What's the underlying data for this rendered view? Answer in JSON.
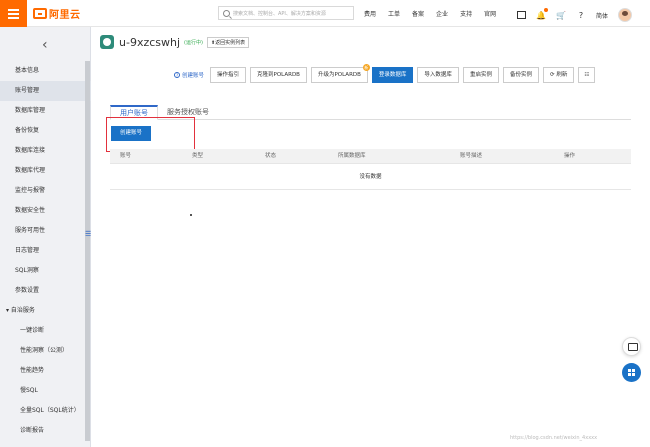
{
  "topbar": {
    "logo_text": "阿里云",
    "search_placeholder": "搜索文档、控制台、API、解决方案和资源",
    "nav": [
      "费用",
      "工单",
      "备案",
      "企业",
      "支持",
      "官网"
    ],
    "language": "简体",
    "brand_color": "#ff6a00"
  },
  "sidebar": {
    "items": [
      {
        "label": "基本信息",
        "type": "item"
      },
      {
        "label": "账号管理",
        "type": "item",
        "active": true
      },
      {
        "label": "数据库管理",
        "type": "item"
      },
      {
        "label": "备份恢复",
        "type": "item"
      },
      {
        "label": "数据库连接",
        "type": "item"
      },
      {
        "label": "数据库代理",
        "type": "item"
      },
      {
        "label": "监控与报警",
        "type": "item"
      },
      {
        "label": "数据安全性",
        "type": "item"
      },
      {
        "label": "服务可用性",
        "type": "item"
      },
      {
        "label": "日志管理",
        "type": "item"
      },
      {
        "label": "SQL洞察",
        "type": "item"
      },
      {
        "label": "参数设置",
        "type": "item"
      },
      {
        "label": "自治服务",
        "type": "group"
      },
      {
        "label": "一键诊断",
        "type": "sub"
      },
      {
        "label": "性能洞察（公测）",
        "type": "sub"
      },
      {
        "label": "性能趋势",
        "type": "sub"
      },
      {
        "label": "慢SQL",
        "type": "sub"
      },
      {
        "label": "全量SQL（SQL统计）",
        "type": "sub"
      },
      {
        "label": "诊断报告",
        "type": "sub"
      }
    ]
  },
  "header": {
    "instance_name": "u-9xzcswhj",
    "status": "(运行中)",
    "back_label": "⬆返回实例列表"
  },
  "toolbar": {
    "help_link": "创建账号",
    "buttons": [
      {
        "label": "操作指引",
        "primary": false
      },
      {
        "label": "克隆到POLARDB",
        "primary": false
      },
      {
        "label": "升级为POLARDB",
        "primary": false,
        "badge": "新"
      },
      {
        "label": "登录数据库",
        "primary": true
      },
      {
        "label": "导入数据库",
        "primary": false
      },
      {
        "label": "重启实例",
        "primary": false
      },
      {
        "label": "备份实例",
        "primary": false
      },
      {
        "label": "刷新",
        "primary": false
      }
    ]
  },
  "main": {
    "tabs": [
      {
        "label": "用户账号",
        "active": true
      },
      {
        "label": "服务授权账号",
        "active": false
      }
    ],
    "create_button": "创建账号",
    "table": {
      "headers": [
        "账号",
        "类型",
        "状态",
        "所属数据库",
        "账号描述",
        "操作"
      ],
      "empty_text": "没有数据"
    }
  },
  "watermark": "https://blog.csdn.net/weixin_4xxxx"
}
